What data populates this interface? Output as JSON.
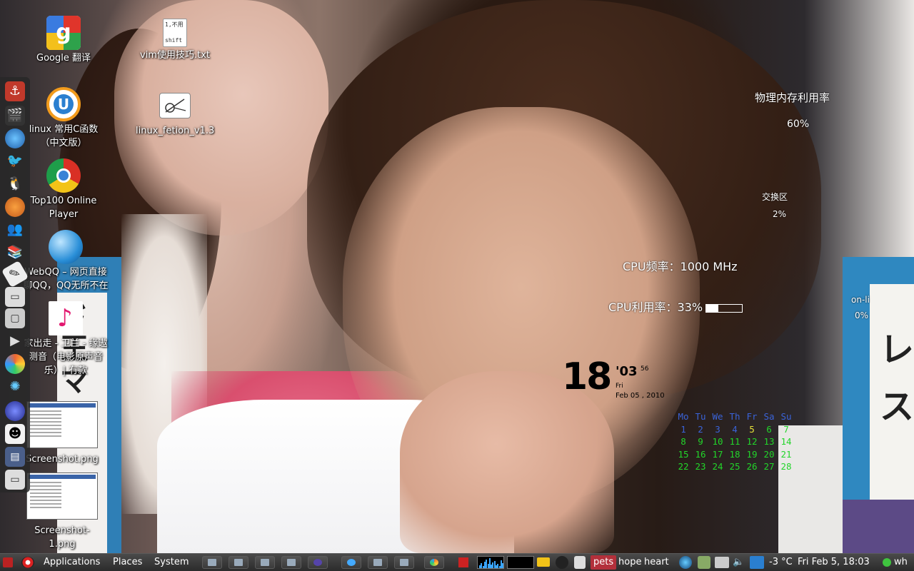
{
  "desktop": {
    "icons": [
      {
        "id": "google-translate",
        "label": "Google 翻译"
      },
      {
        "id": "vim-tips",
        "label": "vim使用技巧.txt",
        "preview": "1,不用\n\nshift"
      },
      {
        "id": "linux-c-func",
        "label": "linux 常用C函数（中文版）"
      },
      {
        "id": "linux-fetion",
        "label": "linux_fetion_v1.3"
      },
      {
        "id": "top100",
        "label": "Top100 Online Player"
      },
      {
        "id": "webqq",
        "label": "WebQQ – 网页直接聊QQ，QQ无所不在"
      },
      {
        "id": "music-file",
        "label": "家出走 - 卫兰 - 缘遨测音（电影原声音乐）| 冇款"
      },
      {
        "id": "screenshot",
        "label": "Screenshot.png"
      },
      {
        "id": "screenshot1",
        "label": "Screenshot-1.png"
      }
    ]
  },
  "conky": {
    "mem_label": "物理内存利用率",
    "mem_value": "60%",
    "swap_label": "交换区",
    "swap_value": "2%",
    "cpu_freq": "CPU频率：1000 MHz",
    "cpu_usage_label": "CPU利用率：33%",
    "cpu_usage_fraction": 0.33,
    "online_label": "on-li",
    "online_value": "0%"
  },
  "clock": {
    "hour": "18",
    "minute": "'03",
    "second": "56",
    "weekday": "Fri",
    "date": "Feb 05 , 2010"
  },
  "calendar": {
    "headers": [
      "Mo",
      "Tu",
      "We",
      "Th",
      "Fr",
      "Sa",
      "Su"
    ],
    "weeks": [
      [
        "1",
        "2",
        "3",
        "4",
        "5",
        "6",
        "7"
      ],
      [
        "8",
        "9",
        "10",
        "11",
        "12",
        "13",
        "14"
      ],
      [
        "15",
        "16",
        "17",
        "18",
        "19",
        "20",
        "21"
      ],
      [
        "22",
        "23",
        "24",
        "25",
        "26",
        "27",
        "28"
      ]
    ],
    "colors": {
      "header": "#3a63d8",
      "first_week": "#3a63d8",
      "today": "#e6e23a",
      "rest": "#22d52a"
    }
  },
  "panel": {
    "menus": [
      "Applications",
      "Places",
      "System"
    ],
    "workspace_tags": [
      "pets",
      "hope",
      "heart"
    ],
    "temperature": "-3 °C",
    "datetime": "Fri Feb 5, 18:03",
    "user": "wh"
  },
  "wallpaper_text": {
    "left_sign": "ド王マの",
    "right_sign": "レス"
  }
}
